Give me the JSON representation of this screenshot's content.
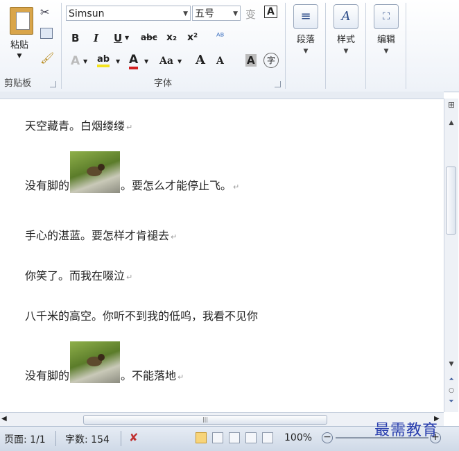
{
  "ribbon": {
    "clipboard": {
      "paste_label": "粘贴",
      "group_label": "剪贴板"
    },
    "font": {
      "font_name": "Simsun",
      "font_size": "五号",
      "group_label": "字体",
      "bold": "B",
      "italic": "I",
      "underline": "U",
      "strikethrough": "abc",
      "subscript": "x₂",
      "superscript": "x²",
      "change_case": "Aa",
      "grow_font": "A",
      "shrink_font": "A",
      "char_shading": "A",
      "enclose_char": "字",
      "phonetic": "变",
      "char_border": "A",
      "text_effects": "A",
      "highlight": "ab",
      "font_color": "A"
    },
    "paragraph_label": "段落",
    "styles_label": "样式",
    "editing_label": "编辑"
  },
  "document": {
    "paragraphs": [
      {
        "text_before": "天空藏青。白烟缕缕",
        "has_image": false,
        "text_after": ""
      },
      {
        "text_before": "没有脚的",
        "has_image": true,
        "text_after": "。要怎么才能停止飞。"
      },
      {
        "text_before": "手心的湛蓝。要怎样才肯褪去",
        "has_image": false,
        "text_after": ""
      },
      {
        "text_before": "你笑了。而我在啜泣",
        "has_image": false,
        "text_after": ""
      },
      {
        "text_before": "八千米的高空。你听不到我的低呜，我看不见你",
        "has_image": false,
        "text_after": ""
      },
      {
        "text_before": "没有脚的",
        "has_image": true,
        "text_after": "。不能落地"
      }
    ],
    "paragraph_mark": "↵"
  },
  "status_bar": {
    "page": "页面: 1/1",
    "word_count": "字数: 154",
    "zoom": "100%"
  },
  "watermark": "最需教育",
  "icons": [
    "paste-icon",
    "cut-icon",
    "copy-icon",
    "format-painter-icon",
    "phonetic-guide-icon",
    "character-border-icon",
    "paragraph-icon",
    "styles-icon",
    "find-icon",
    "spell-check-icon",
    "print-layout-icon",
    "full-screen-icon",
    "web-layout-icon",
    "outline-icon",
    "draft-icon",
    "zoom-out-icon",
    "zoom-in-icon"
  ]
}
